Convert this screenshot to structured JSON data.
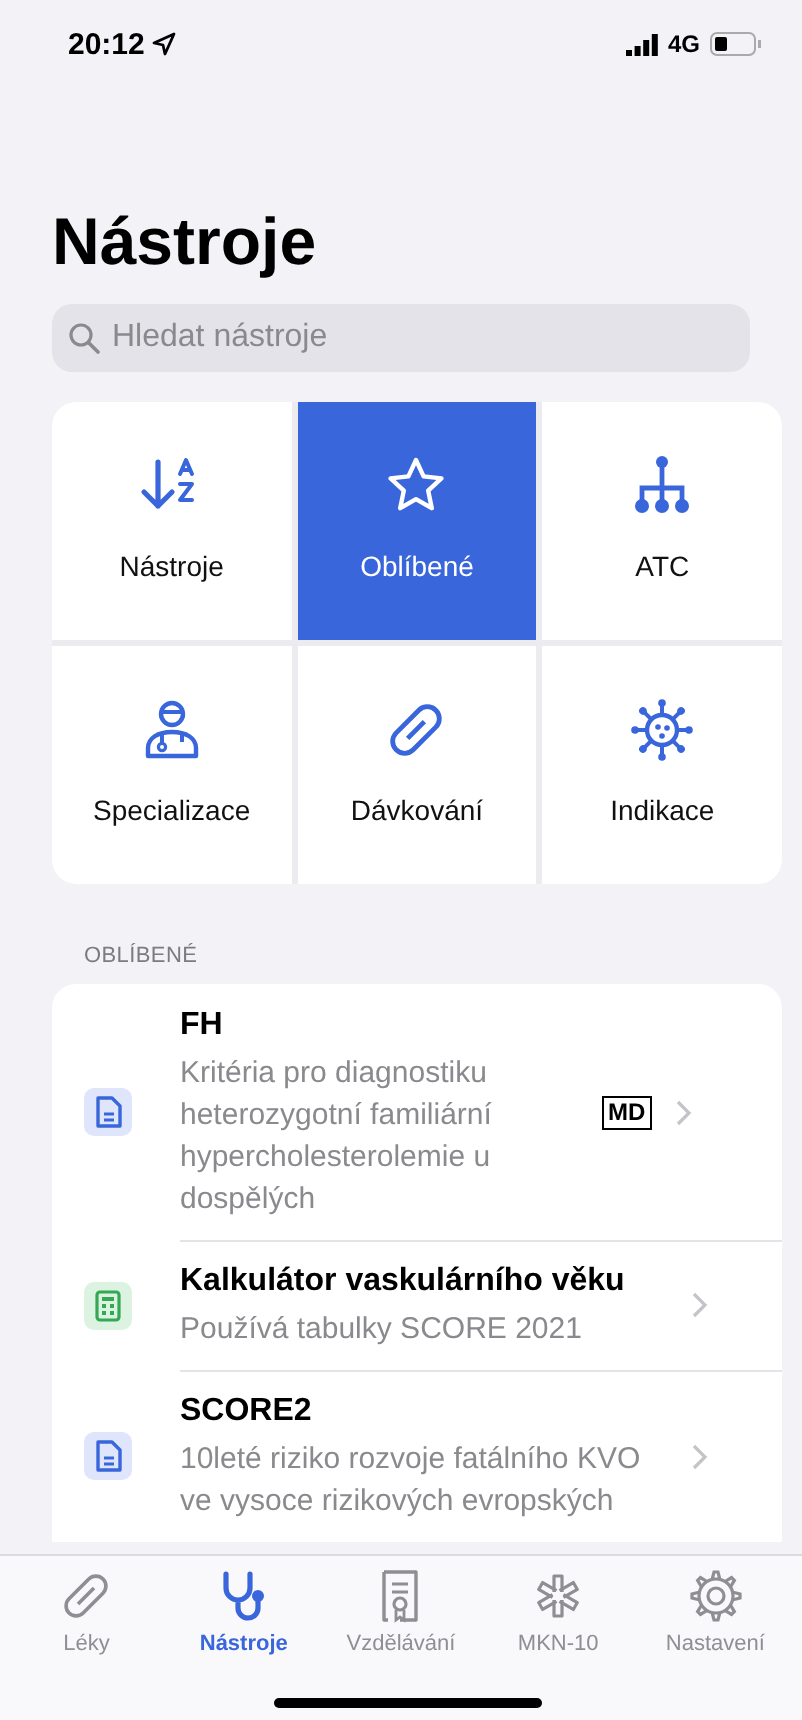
{
  "status_bar": {
    "time": "20:12",
    "network": "4G"
  },
  "title": "Nástroje",
  "search": {
    "placeholder": "Hledat nástroje"
  },
  "tools": [
    {
      "label": "Nástroje",
      "selected": false
    },
    {
      "label": "Oblíbené",
      "selected": true
    },
    {
      "label": "ATC",
      "selected": false
    },
    {
      "label": "Specializace",
      "selected": false
    },
    {
      "label": "Dávkování",
      "selected": false
    },
    {
      "label": "Indikace",
      "selected": false
    }
  ],
  "favorites": {
    "heading": "OBLÍBENÉ",
    "items": [
      {
        "kind": "document",
        "title": "FH",
        "subtitle": "Kritéria pro diagnostiku heterozygotní familiární hypercholesterolemie u dospělých",
        "badge": "MD"
      },
      {
        "kind": "calculator",
        "title": "Kalkulátor vaskulárního věku",
        "subtitle": "Používá tabulky SCORE 2021"
      },
      {
        "kind": "document",
        "title": "SCORE2",
        "subtitle": "10leté riziko rozvoje fatálního KVO ve vysoce rizikových evropských"
      }
    ]
  },
  "tab_bar": [
    {
      "label": "Léky",
      "selected": false
    },
    {
      "label": "Nástroje",
      "selected": true
    },
    {
      "label": "Vzdělávání",
      "selected": false
    },
    {
      "label": "MKN-10",
      "selected": false
    },
    {
      "label": "Nastavení",
      "selected": false
    }
  ]
}
